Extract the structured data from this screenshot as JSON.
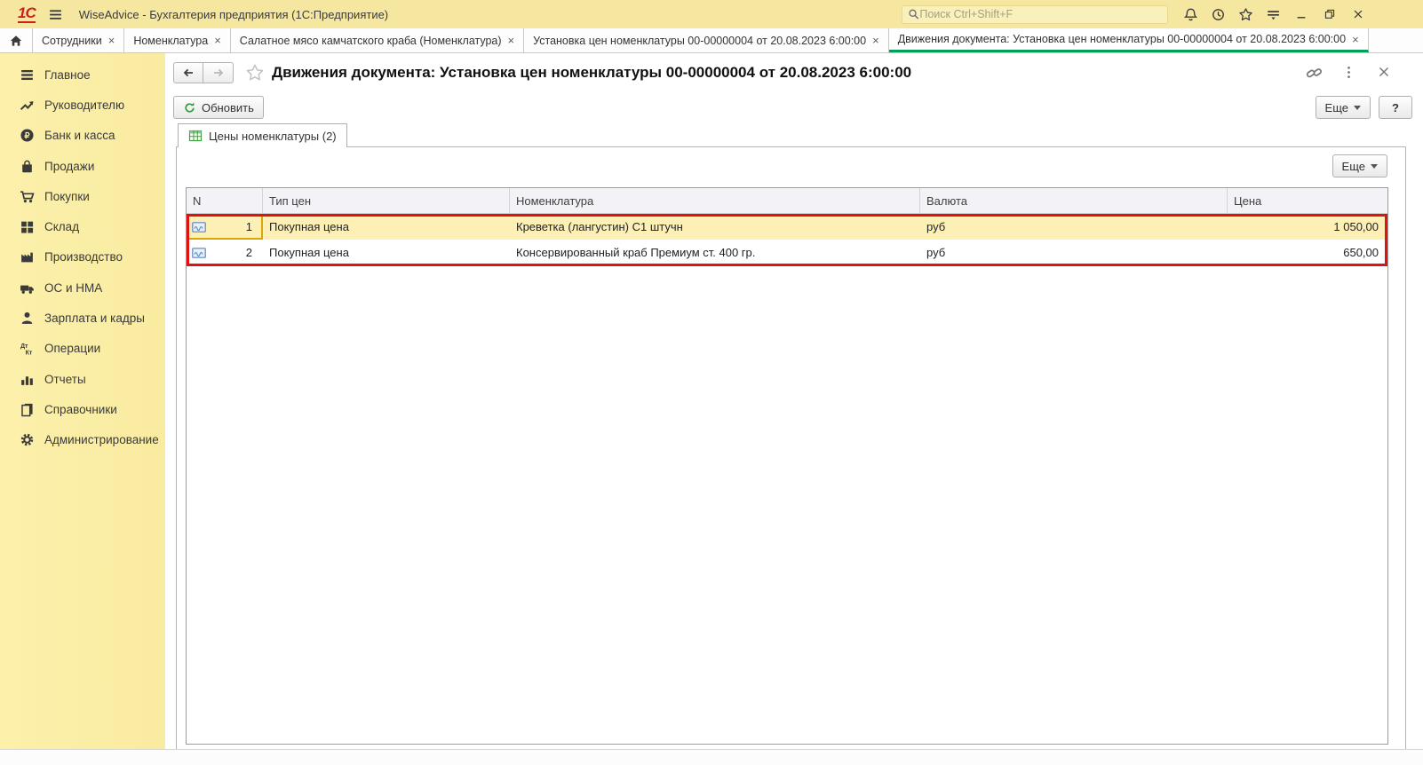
{
  "titlebar": {
    "app_title": "WiseAdvice - Бухгалтерия предприятия  (1С:Предприятие)",
    "logo": "1С",
    "search_placeholder": "Поиск Ctrl+Shift+F"
  },
  "tabs": [
    {
      "label": "Сотрудники",
      "close": "×"
    },
    {
      "label": "Номенклатура",
      "close": "×"
    },
    {
      "label": "Салатное мясо камчатского краба (Номенклатура)",
      "close": "×"
    },
    {
      "label": "Установка цен номенклатуры 00-00000004 от 20.08.2023 6:00:00",
      "close": "×"
    },
    {
      "label": "Движения документа: Установка цен номенклатуры 00-00000004 от 20.08.2023 6:00:00",
      "close": "×",
      "active": true
    }
  ],
  "sidebar": {
    "items": [
      {
        "label": "Главное",
        "icon": "menu-lines-icon"
      },
      {
        "label": "Руководителю",
        "icon": "trend-up-icon"
      },
      {
        "label": "Банк и касса",
        "icon": "ruble-circle-icon"
      },
      {
        "label": "Продажи",
        "icon": "shopping-bag-icon"
      },
      {
        "label": "Покупки",
        "icon": "shopping-cart-icon"
      },
      {
        "label": "Склад",
        "icon": "grid-blocks-icon"
      },
      {
        "label": "Производство",
        "icon": "factory-icon"
      },
      {
        "label": "ОС и НМА",
        "icon": "truck-icon"
      },
      {
        "label": "Зарплата и кадры",
        "icon": "person-icon"
      },
      {
        "label": "Операции",
        "icon": "dt-kt-icon"
      },
      {
        "label": "Отчеты",
        "icon": "bar-chart-icon"
      },
      {
        "label": "Справочники",
        "icon": "books-icon"
      },
      {
        "label": "Администрирование",
        "icon": "gear-icon"
      }
    ]
  },
  "document": {
    "title": "Движения документа: Установка цен номенклатуры 00-00000004 от 20.08.2023 6:00:00",
    "refresh_label": "Обновить",
    "more_label": "Еще",
    "help_label": "?",
    "form_tab_label": "Цены номенклатуры (2)"
  },
  "table": {
    "more_label": "Еще",
    "columns": [
      "N",
      "Тип цен",
      "Номенклатура",
      "Валюта",
      "Цена"
    ],
    "rows": [
      {
        "n": "1",
        "price_type": "Покупная цена",
        "nomenclature": "Креветка (лангустин) С1 штучн",
        "currency": "руб",
        "price": "1 050,00",
        "selected": true
      },
      {
        "n": "2",
        "price_type": "Покупная цена",
        "nomenclature": "Консервированный краб Премиум ст. 400 гр.",
        "currency": "руб",
        "price": "650,00",
        "selected": false
      }
    ]
  },
  "colors": {
    "titlebar_bg": "#f6e7a0",
    "sidebar_bg": "#fbeda6",
    "active_tab_green": "#00a05a",
    "selected_row_bg": "#fdf0b6",
    "annotation_red": "#e11212",
    "logo_red": "#cf1d1d"
  }
}
